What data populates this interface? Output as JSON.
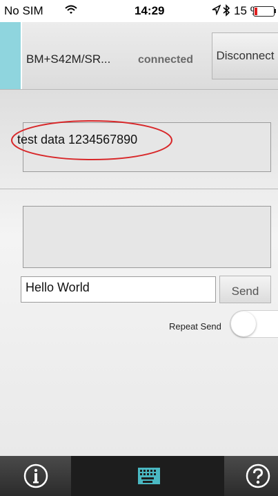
{
  "status_bar": {
    "carrier": "No SIM",
    "wifi_icon": "wifi-icon",
    "time": "14:29",
    "location_icon": "location-arrow-icon",
    "bluetooth_icon": "bluetooth-icon",
    "battery_percent": "15 %",
    "battery_level": 0.15,
    "battery_color": "#e02020"
  },
  "header": {
    "device_name": "BM+S42M/SR...",
    "connection_status": "connected",
    "disconnect_label": "Disconnect",
    "accent_color": "#8fd5de"
  },
  "receive": {
    "text": "test data 1234567890",
    "highlight_color": "#d8282a"
  },
  "send": {
    "input_value": "Hello World",
    "send_label": "Send",
    "repeat_send_label": "Repeat Send",
    "repeat_send_enabled": false
  },
  "tab_bar": {
    "items": [
      {
        "icon": "info-icon",
        "selected": false
      },
      {
        "icon": "keyboard-icon",
        "selected": true
      },
      {
        "icon": "help-icon",
        "selected": false
      }
    ],
    "selected_color": "#4ab8c2"
  }
}
